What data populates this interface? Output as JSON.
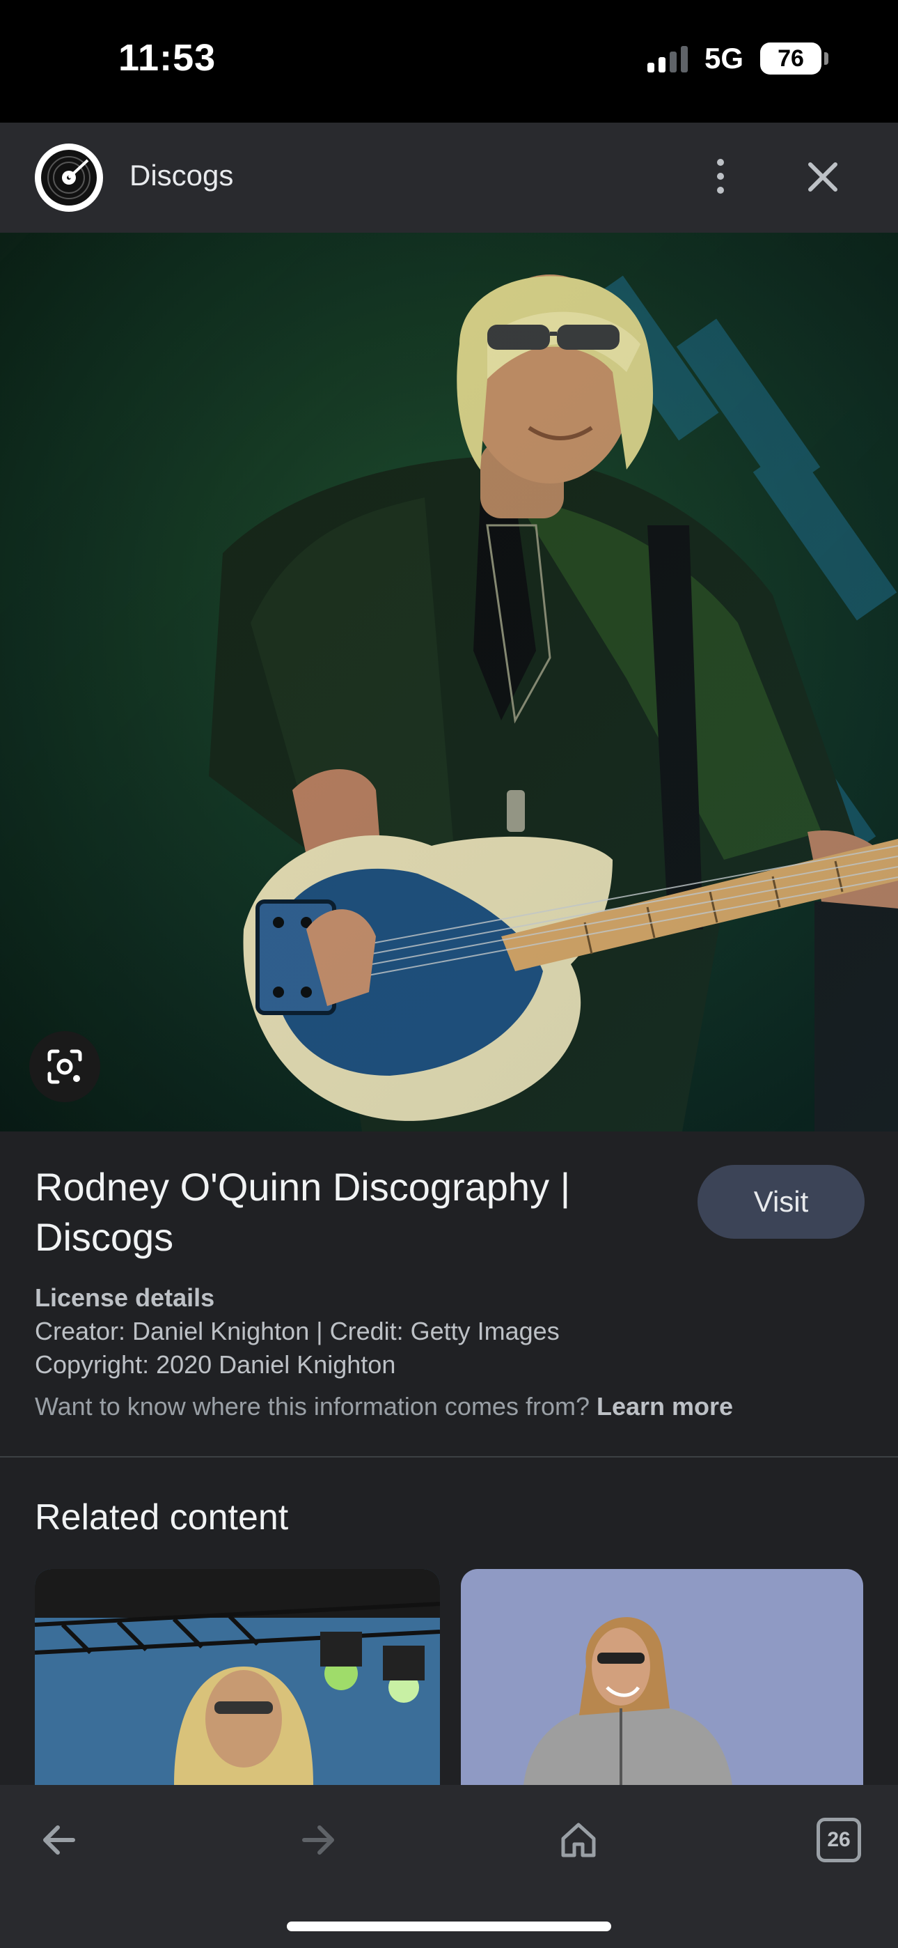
{
  "status_bar": {
    "time": "11:53",
    "network": "5G",
    "battery": "76"
  },
  "header": {
    "site_name": "Discogs"
  },
  "result": {
    "title": "Rodney O'Quinn Discography | Discogs",
    "visit_label": "Visit",
    "license_heading": "License details",
    "creator_line": "Creator: Daniel Knighton | Credit: Getty Images",
    "copyright_line": "Copyright: 2020 Daniel Knighton",
    "info_text": "Want to know where this information comes from? ",
    "learn_more": "Learn more"
  },
  "related": {
    "heading": "Related content"
  },
  "bottom_nav": {
    "tabs_count": "26"
  },
  "icons": {
    "logo": "vinyl-record-icon",
    "more": "more-vert-icon",
    "close": "close-icon",
    "lens": "google-lens-icon",
    "back": "arrow-back-icon",
    "forward": "arrow-forward-icon",
    "home": "home-icon",
    "tabs": "tab-switcher-icon"
  },
  "colors": {
    "background": "#202124",
    "bar": "#292a2e",
    "visit_button": "#3c4457"
  }
}
